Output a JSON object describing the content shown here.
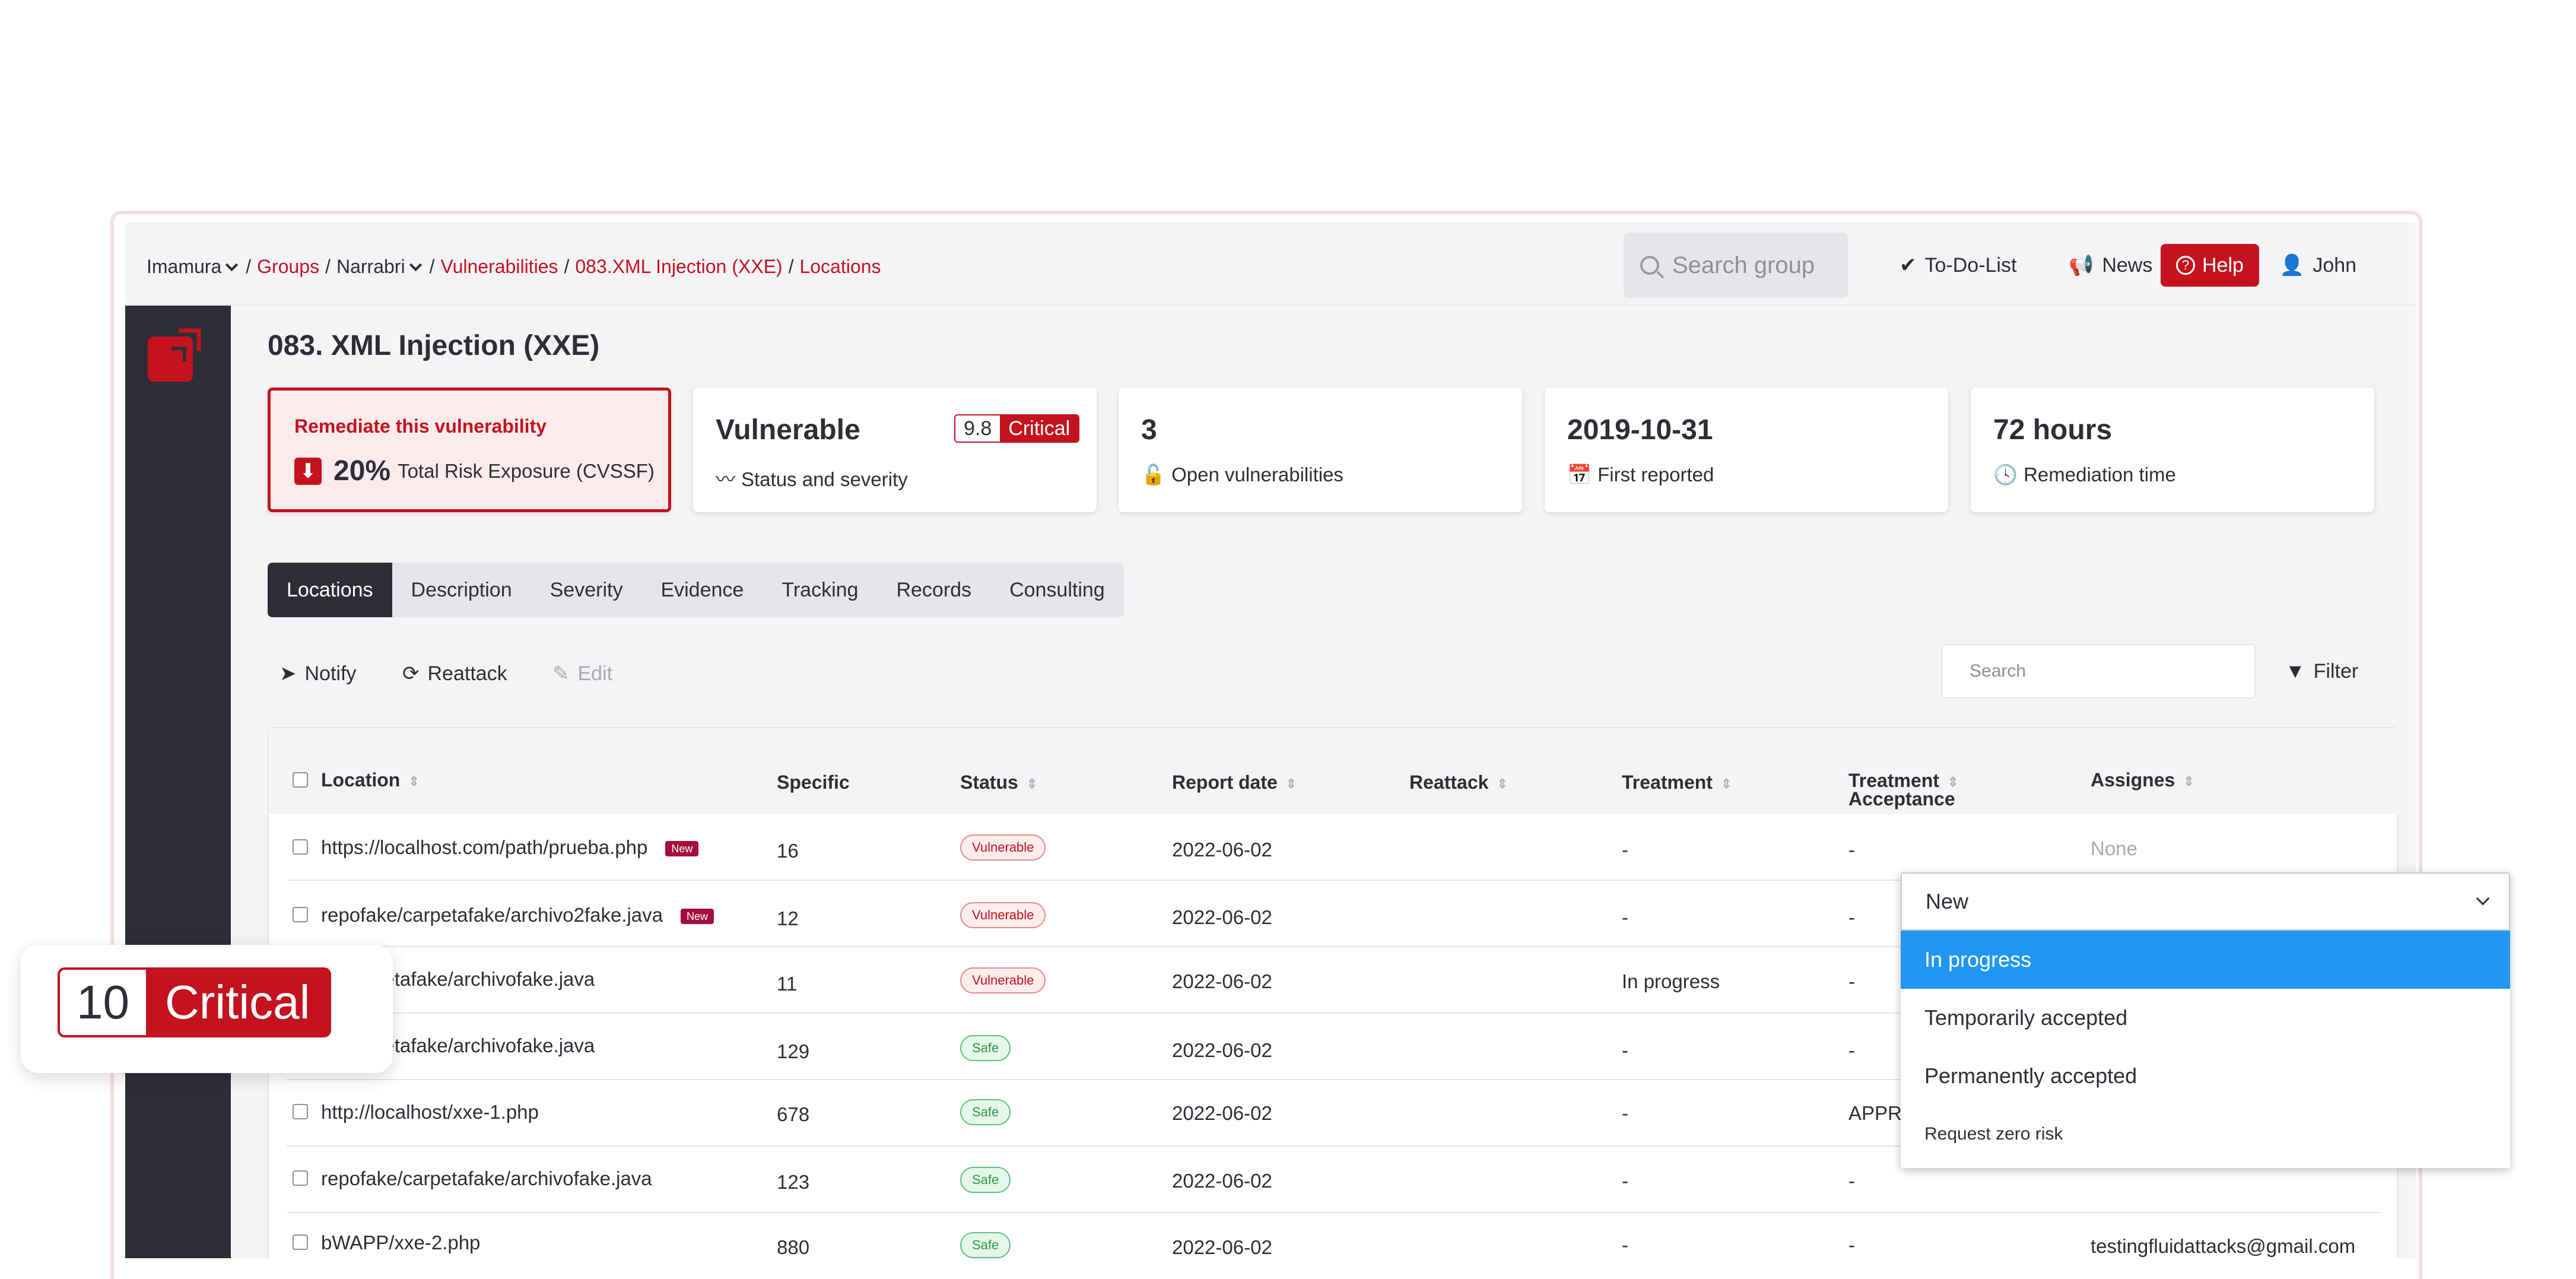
{
  "breadcrumb": {
    "org": "Imamura",
    "groups": "Groups",
    "group": "Narrabri",
    "vulnerabilities": "Vulnerabilities",
    "finding": "083.XML Injection (XXE)",
    "current": "Locations"
  },
  "topbar": {
    "search_placeholder": "Search group",
    "todo": "To-Do-List",
    "news": "News",
    "help": "Help",
    "user": "John"
  },
  "page_title": "083. XML Injection (XXE)",
  "cards": {
    "remediate": {
      "title": "Remediate this vulnerability",
      "percent": "20%",
      "label": "Total Risk Exposure (CVSSF)"
    },
    "status": {
      "value": "Vulnerable",
      "score": "9.8",
      "severity": "Critical",
      "label": "Status and severity"
    },
    "open": {
      "value": "3",
      "label": "Open vulnerabilities"
    },
    "reported": {
      "value": "2019-10-31",
      "label": "First reported"
    },
    "remediation": {
      "value": "72 hours",
      "label": "Remediation time"
    }
  },
  "tabs": [
    "Locations",
    "Description",
    "Severity",
    "Evidence",
    "Tracking",
    "Records",
    "Consulting"
  ],
  "actions": {
    "notify": "Notify",
    "reattack": "Reattack",
    "edit": "Edit",
    "search_placeholder": "Search",
    "filter": "Filter"
  },
  "table": {
    "headers": {
      "location": "Location",
      "specific": "Specific",
      "status": "Status",
      "report_date": "Report date",
      "reattack": "Reattack",
      "treatment": "Treatment",
      "acceptance_1": "Treatment",
      "acceptance_2": "Acceptance",
      "assignes": "Assignes"
    },
    "rows": [
      {
        "location": "https://localhost.com/path/prueba.php",
        "badge": "New",
        "specific": "16",
        "status": "Vulnerable",
        "date": "2022-06-02",
        "treatment": "-",
        "acceptance": "-",
        "assignee": "None"
      },
      {
        "location": "repofake/carpetafake/archivo2fake.java",
        "badge": "New",
        "specific": "12",
        "status": "Vulnerable",
        "date": "2022-06-02",
        "treatment": "-",
        "acceptance": "-",
        "assignee": ""
      },
      {
        "location": "/carpetafake/archivofake.java",
        "badge": "",
        "specific": "11",
        "status": "Vulnerable",
        "date": "2022-06-02",
        "treatment": "In progress",
        "acceptance": "-",
        "assignee": ""
      },
      {
        "location": "/carpetafake/archivofake.java",
        "badge": "",
        "specific": "129",
        "status": "Safe",
        "date": "2022-06-02",
        "treatment": "-",
        "acceptance": "-",
        "assignee": ""
      },
      {
        "location": "http://localhost/xxe-1.php",
        "badge": "",
        "specific": "678",
        "status": "Safe",
        "date": "2022-06-02",
        "treatment": "-",
        "acceptance": "APPRO",
        "assignee": ""
      },
      {
        "location": "repofake/carpetafake/archivofake.java",
        "badge": "",
        "specific": "123",
        "status": "Safe",
        "date": "2022-06-02",
        "treatment": "-",
        "acceptance": "-",
        "assignee": ""
      },
      {
        "location": "bWAPP/xxe-2.php",
        "badge": "",
        "specific": "880",
        "status": "Safe",
        "date": "2022-06-02",
        "treatment": "-",
        "acceptance": "-",
        "assignee": "testingfluidattacks@gmail.com"
      }
    ]
  },
  "dropdown": {
    "selected": "New",
    "options": [
      "In progress",
      "Temporarily accepted",
      "Permanently accepted",
      "Request zero risk"
    ]
  },
  "floating_badge": {
    "count": "10",
    "severity": "Critical"
  },
  "colors": {
    "brand_red": "#c4121f",
    "dark": "#2e2e38",
    "selected_blue": "#2196f3"
  }
}
